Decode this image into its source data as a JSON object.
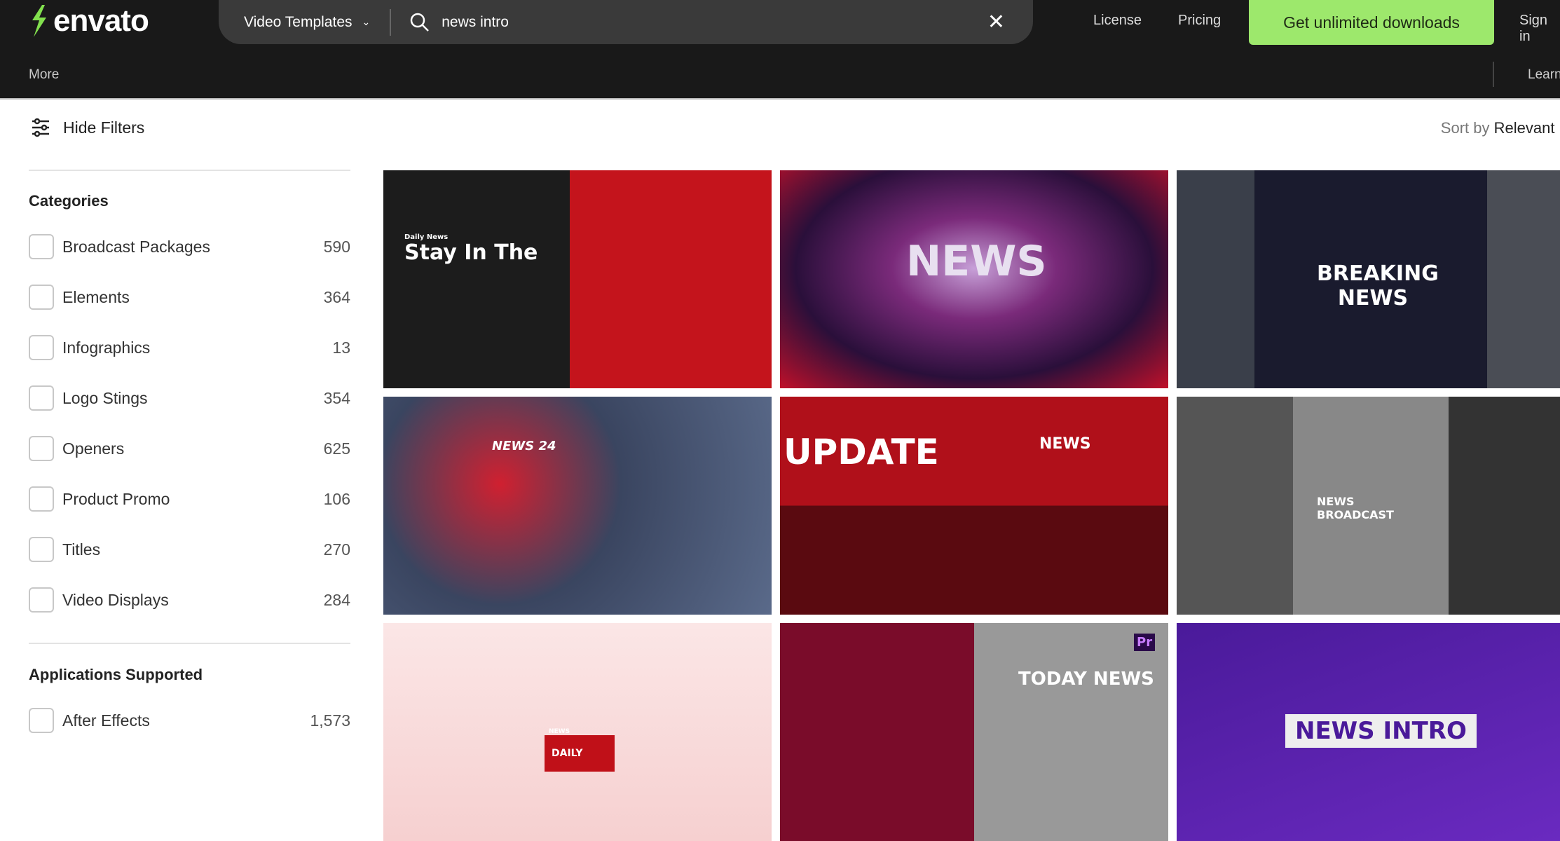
{
  "header": {
    "logo": "envato",
    "category": "Video Templates",
    "query": "news intro",
    "nav": [
      "License",
      "Pricing"
    ],
    "cta": "Get unlimited downloads",
    "sign_in": "Sign in",
    "more": "More",
    "learn": "Learn"
  },
  "toolbar": {
    "hide_filters": "Hide Filters",
    "sort_prefix": "Sort by",
    "sort_value": "Relevant"
  },
  "sidebar": {
    "categories_title": "Categories",
    "categories": [
      {
        "label": "Broadcast Packages",
        "count": "590"
      },
      {
        "label": "Elements",
        "count": "364"
      },
      {
        "label": "Infographics",
        "count": "13"
      },
      {
        "label": "Logo Stings",
        "count": "354"
      },
      {
        "label": "Openers",
        "count": "625"
      },
      {
        "label": "Product Promo",
        "count": "106"
      },
      {
        "label": "Titles",
        "count": "270"
      },
      {
        "label": "Video Displays",
        "count": "284"
      }
    ],
    "apps_title": "Applications Supported",
    "apps": [
      {
        "label": "After Effects",
        "count": "1,573"
      }
    ]
  },
  "results": [
    {
      "text": "Stay In The",
      "sub": "Daily News"
    },
    {
      "text": "NEWS"
    },
    {
      "text": "BREAKING NEWS"
    },
    {
      "text": "NEWS 24"
    },
    {
      "text": "UPDATE",
      "sub": "NEWS"
    },
    {
      "text": "NEWS BROADCAST"
    },
    {
      "text": "DAILY",
      "sub": "NEWS"
    },
    {
      "text": "TODAY NEWS",
      "sub": "Pr"
    },
    {
      "text": "NEWS INTRO"
    }
  ],
  "colors": {
    "accent": "#9de86c",
    "header": "#191919"
  }
}
